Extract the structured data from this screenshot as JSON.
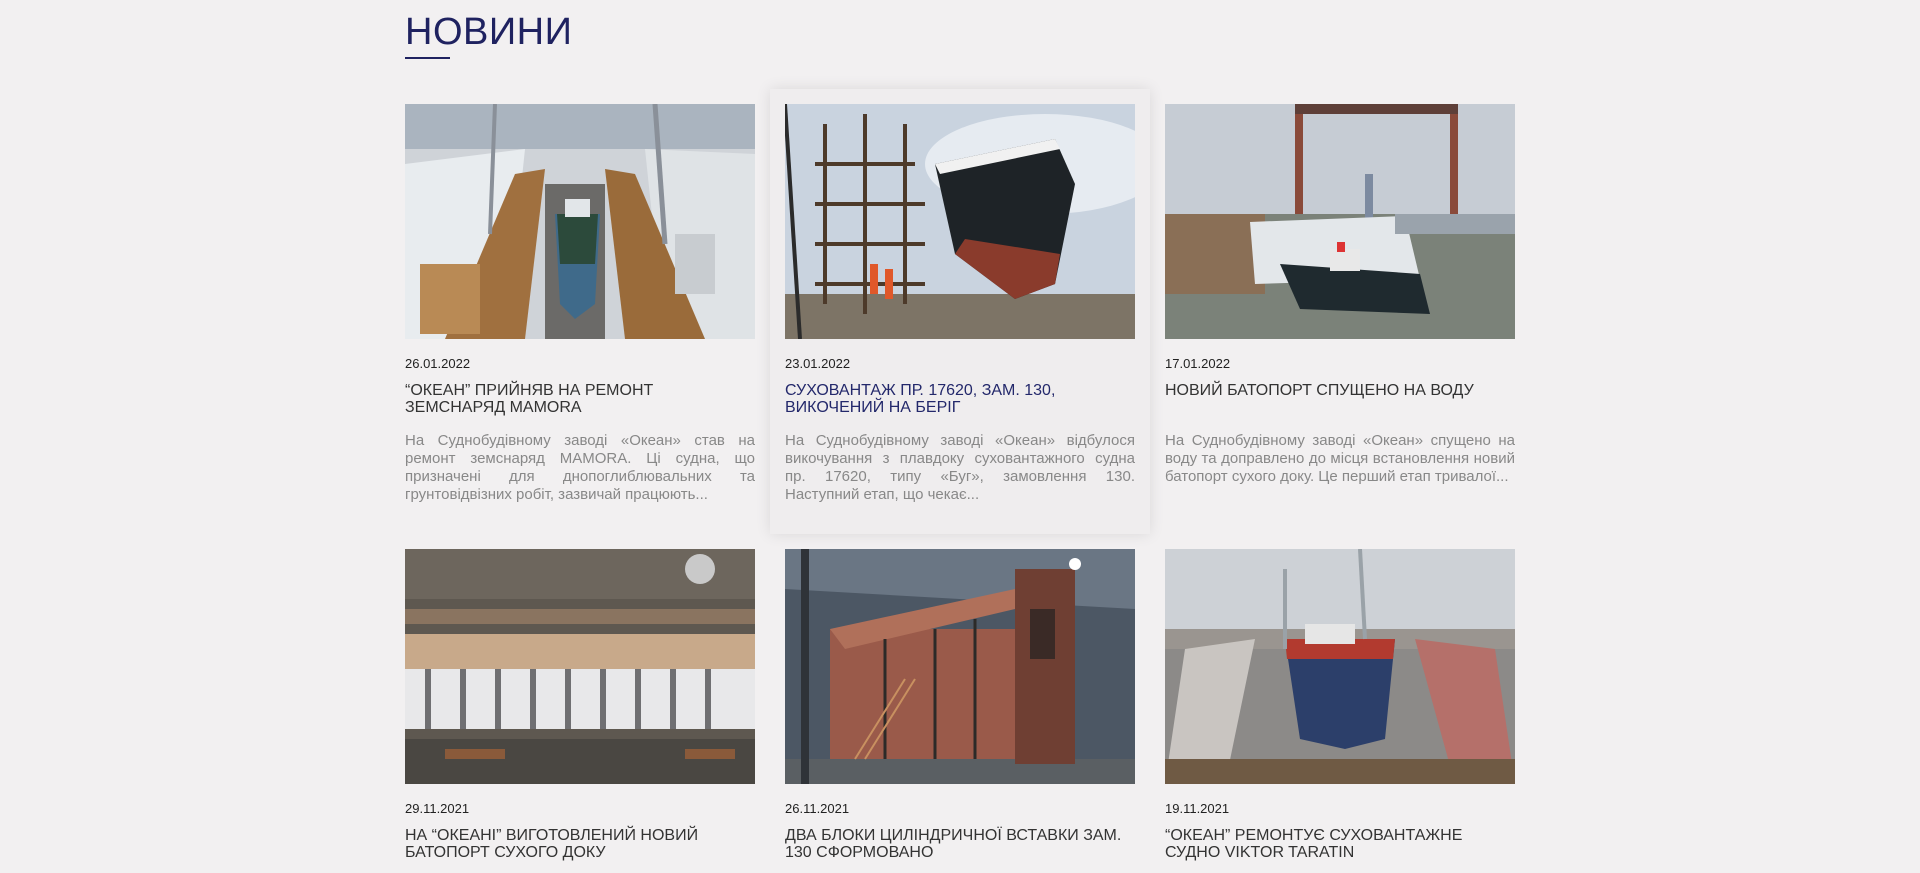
{
  "section": {
    "title": "НОВИНИ"
  },
  "colors": {
    "accent": "#1f2260",
    "background": "#f2f0f1",
    "muted_text": "#888888"
  },
  "news": [
    {
      "date": "26.01.2022",
      "title": "“ОКЕАН” ПРИЙНЯВ НА РЕМОНТ ЗЕМСНАРЯД MAMORA",
      "excerpt": "На Суднобудівному заводі «Океан» став на ремонт земснаряд MAMORA. Ці судна, що призначені для днопоглиблювальних та грунтовідвізних робіт, зазвичай працюють...",
      "image": "dry-dock-winter-photo"
    },
    {
      "date": "23.01.2022",
      "title": "СУХОВАНТАЖ ПР. 17620, ЗАМ. 130, ВИКОЧЕНИЙ НА БЕРІГ",
      "excerpt": "На Суднобудівному заводі «Океан» відбулося викочування з плавдоку суховантажного судна пр. 17620, типу «Буг», замовлення 130. Наступний етап, що чекає...",
      "image": "ship-bow-scaffold-photo"
    },
    {
      "date": "17.01.2022",
      "title": "НОВИЙ БАТОПОРТ СПУЩЕНО НА ВОДУ",
      "excerpt": "На Суднобудівному заводі «Океан» спущено на воду та доправлено до місця встановлення новий батопорт сухого доку. Це перший етап тривалої...",
      "image": "batoport-tug-photo"
    },
    {
      "date": "29.11.2021",
      "title": "НА “ОКЕАНІ” ВИГОТОВЛЕНИЙ НОВИЙ БАТОПОРТ СУХОГО ДОКУ",
      "excerpt": "",
      "image": "batoport-aerial-photo"
    },
    {
      "date": "26.11.2021",
      "title": "ДВА БЛОКИ ЦИЛІНДРИЧНОЇ ВСТАВКИ ЗАМ. 130 СФОРМОВАНО",
      "excerpt": "",
      "image": "hull-blocks-workshop-photo"
    },
    {
      "date": "19.11.2021",
      "title": "“ОКЕАН” РЕМОНТУЄ СУХОВАНТАЖНЕ СУДНО VIKTOR TARATIN",
      "excerpt": "",
      "image": "cargo-ship-drydock-photo"
    }
  ]
}
